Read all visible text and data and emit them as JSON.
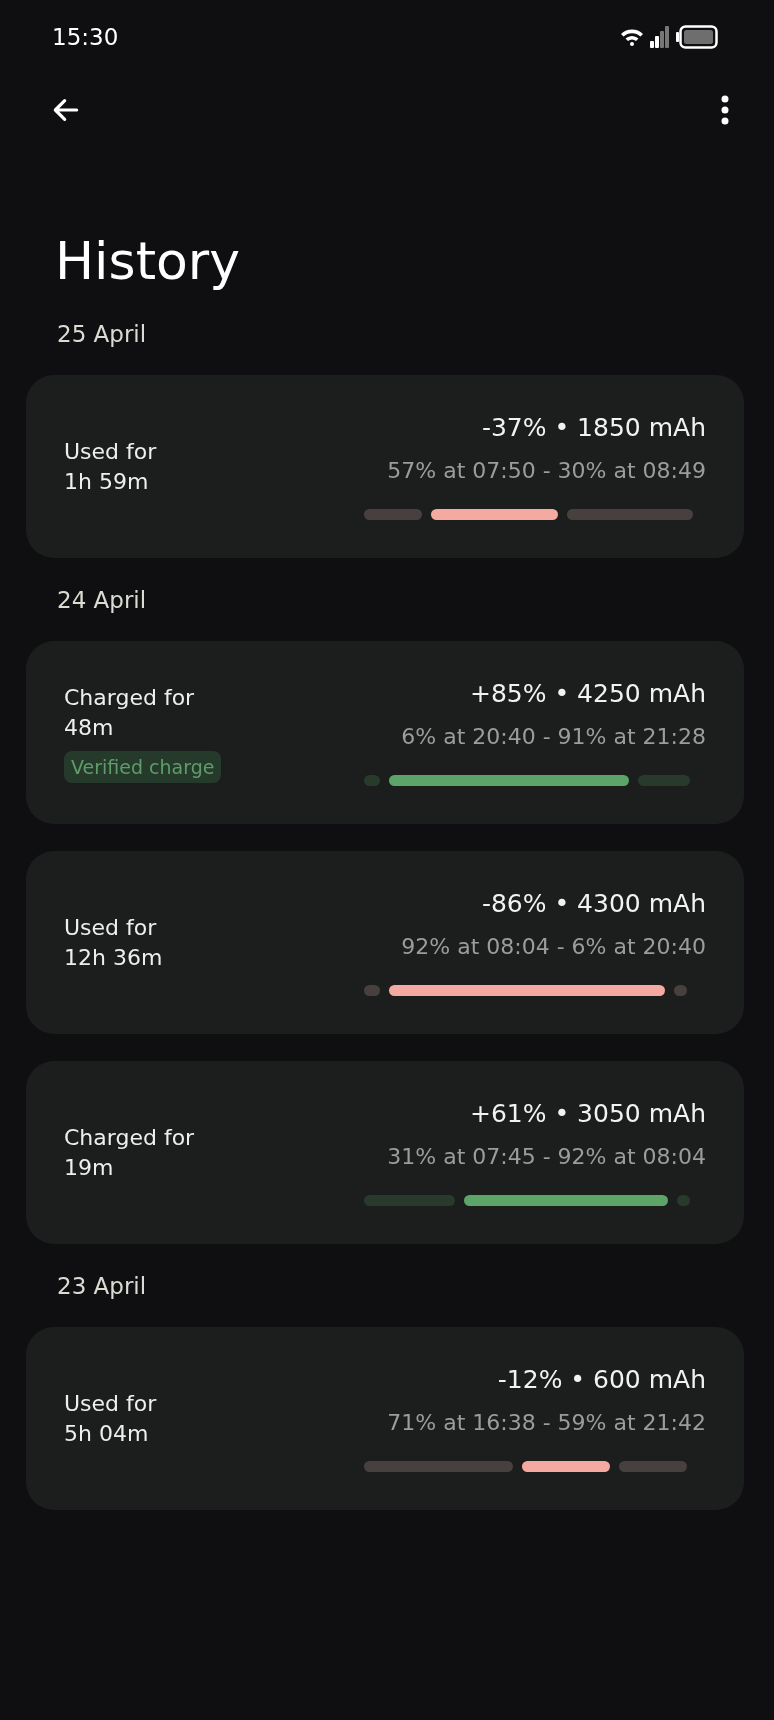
{
  "status_bar": {
    "time": "15:30"
  },
  "title": "History",
  "groups": [
    {
      "date": "25 April",
      "entries": [
        {
          "kind": "used",
          "label": "Used for",
          "duration": "1h 59m",
          "summary": "-37% • 1850 mAh",
          "range": "57% at 07:50 - 30% at 08:49",
          "segments": [
            {
              "active": false
            },
            {
              "active": true
            },
            {
              "active": false
            }
          ]
        }
      ]
    },
    {
      "date": "24 April",
      "entries": [
        {
          "kind": "charged",
          "label": "Charged for",
          "duration": "48m",
          "badge": "Verified charge",
          "summary": "+85% • 4250 mAh",
          "range": "6% at 20:40 - 91% at 21:28",
          "segments": [
            {
              "active": false
            },
            {
              "active": true
            },
            {
              "active": false
            }
          ]
        },
        {
          "kind": "used",
          "label": "Used for",
          "duration": "12h 36m",
          "summary": "-86% • 4300 mAh",
          "range": "92% at 08:04 - 6% at 20:40",
          "segments": [
            {
              "active": false
            },
            {
              "active": true
            },
            {
              "active": false
            }
          ]
        },
        {
          "kind": "charged",
          "label": "Charged for",
          "duration": "19m",
          "summary": "+61% • 3050 mAh",
          "range": "31% at 07:45 - 92% at 08:04",
          "segments": [
            {
              "active": false
            },
            {
              "active": true
            },
            {
              "active": false
            }
          ]
        }
      ]
    },
    {
      "date": "23 April",
      "entries": [
        {
          "kind": "used",
          "label": "Used for",
          "duration": "5h 04m",
          "summary": "-12% • 600 mAh",
          "range": "71% at 16:38 - 59% at 21:42",
          "segments": [
            {
              "active": false
            },
            {
              "active": true
            },
            {
              "active": false
            }
          ]
        }
      ]
    }
  ]
}
